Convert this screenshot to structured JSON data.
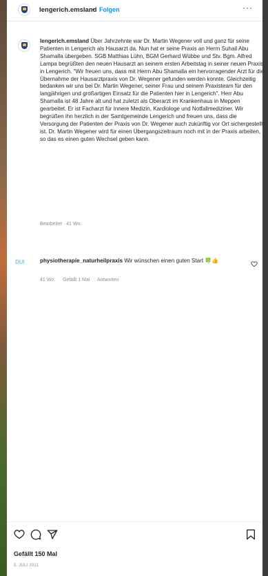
{
  "header": {
    "username": "lengerich.emsland",
    "separator": "•",
    "follow_label": "Folgen",
    "more_label": "···"
  },
  "caption": {
    "username": "lengerich.emsland",
    "text": "Über Jahrzehnte war Dr. Martin Wegener voll und ganz für seine Patienten in Lengerich als Hausarzt da. Nun hat er seine Praxis an Herrn Suhail Abu Shamalla übergeben. SGB Matthias Lühn, BGM Gerhard Wübbe und Stv. Bgm. Alfred Lampa begrüßten den neuen Hausarzt an seinem ersten Arbeitstag in seiner neuen Praxis in Lengerich. \"Wir freuen uns, dass mit Herrn Abu Shamalla ein hervorragender Arzt für die Übernahme der Hausarztpraxis von Dr. Wegener gefunden werden konnte. Gleichzeitig bedanken wir uns bei Dr. Martin Wegener, seiner Frau und seinem Praxisteam für den langjährigen und großartigen Einsatz für die Patienten hier in Lengerich\". Herr Abu Shamalla ist 48 Jahre alt und hat zuletzt als Oberarzt im Krankenhaus in Meppen gearbeitet. Er ist Facharzt für Innere Medizin, Kardiologe und Notfallmediziner. Wir begrüßen ihn herzlich in der Samtgemeinde Lengerich und freuen uns, dass die Versorgung der Patienten der Praxis von Dr. Wegener auch zukünftig vor Ort sichergestellt ist. Dr. Martin Wegener wird für einen Übergangszeitraum noch mit in der Praxis arbeiten, so das es einen guten Wechsel geben kann.",
    "edited": "Bearbeitet · 41 Wo."
  },
  "comment": {
    "avatar_text": "DUI",
    "username": "physiotherapie_naturheilpraxis",
    "text": "Wir wünschen einen guten Start 🍀👍",
    "age": "41 Wo.",
    "likes": "Gefällt 1 Mal",
    "reply": "Antworten"
  },
  "post": {
    "likes": "Gefällt 150 Mal",
    "date": "5. JULI 2021"
  }
}
